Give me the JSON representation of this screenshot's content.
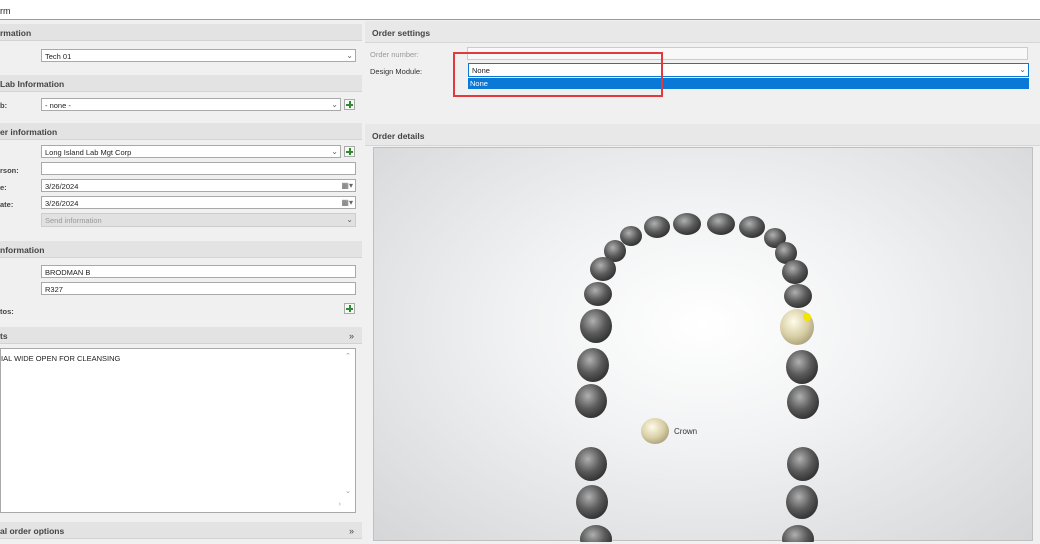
{
  "window": {
    "title_fragment": "rm"
  },
  "left": {
    "sections": {
      "information": "rmation",
      "lab_info": "Lab Information",
      "order_info": "er information",
      "patient_info": "nformation",
      "comments": "ts",
      "additional": "al order options"
    },
    "technician": {
      "value": "Tech 01"
    },
    "lab": {
      "label": "b:",
      "value": "- none -"
    },
    "order": {
      "client_value": "Long Island Lab Mgt Corp",
      "contact_label": "rson:",
      "date1_label": "e:",
      "date1_value": "3/26/2024",
      "date2_label": "ate:",
      "date2_value": "3/26/2024",
      "send_info": "Send information"
    },
    "patient": {
      "name_value": "BRODMAN B",
      "id_value": "R327",
      "photos_label": "tos:"
    },
    "comments_text": "IAL WIDE OPEN FOR CLEANSING"
  },
  "right": {
    "order_settings_title": "Order settings",
    "order_number_label": "Order number:",
    "order_number_value": "",
    "design_module_label": "Design Module:",
    "design_module_value": "None",
    "dropdown_option": "None",
    "order_details_title": "Order details",
    "crown_label": "Crown"
  }
}
